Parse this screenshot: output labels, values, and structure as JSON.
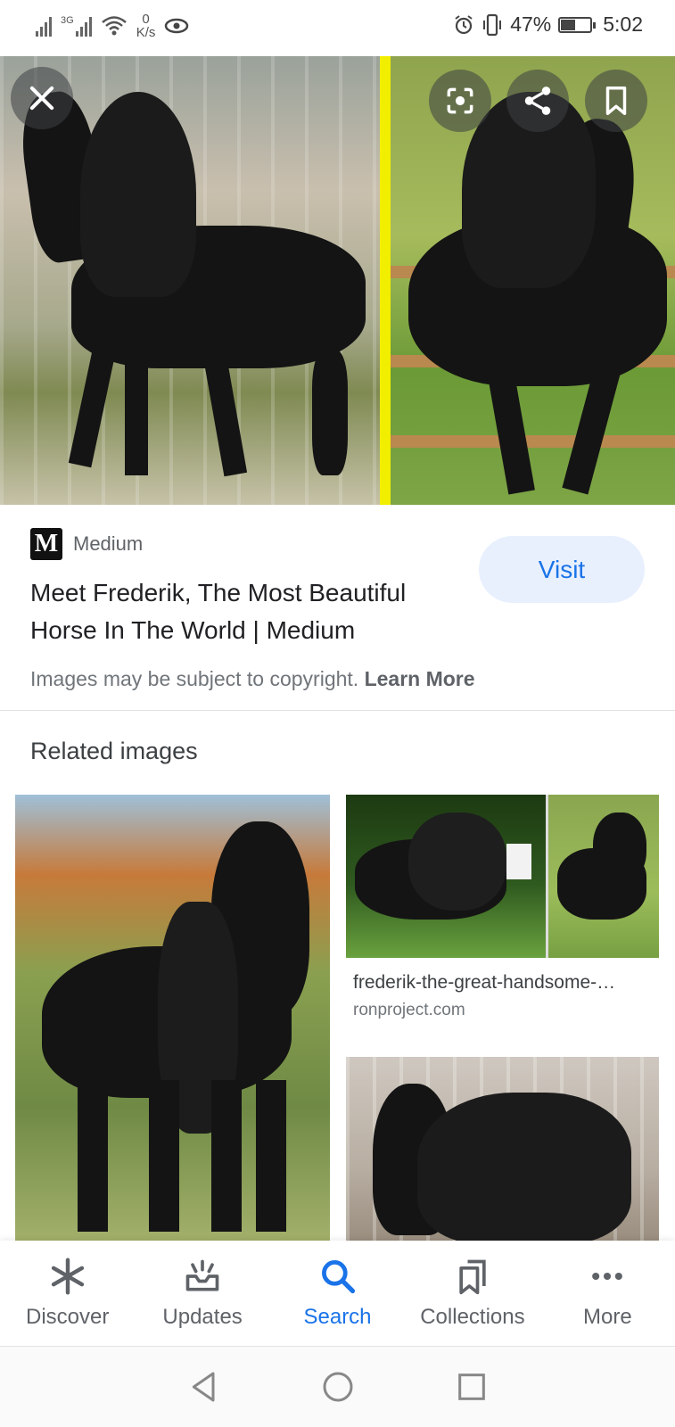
{
  "status_bar": {
    "network_type": "3G",
    "net_speed_value": "0",
    "net_speed_unit": "K/s",
    "battery_percent": "47%",
    "battery_level": 0.47,
    "time": "5:02"
  },
  "hero": {
    "icons": [
      "close-icon",
      "lens-icon",
      "share-icon",
      "bookmark-icon"
    ]
  },
  "result": {
    "source_favicon": "M",
    "source_name": "Medium",
    "title": "Meet Frederik, The Most Beautiful Horse In The World | Medium",
    "visit_label": "Visit",
    "copyright_text": "Images may be subject to copyright.",
    "learn_more": "Learn More"
  },
  "related": {
    "heading": "Related images",
    "items": [
      {
        "title": "frederik-the-great-handsome-…",
        "site": "ronproject.com"
      }
    ]
  },
  "bottom_nav": {
    "items": [
      {
        "label": "Discover",
        "icon": "asterisk-icon"
      },
      {
        "label": "Updates",
        "icon": "updates-icon"
      },
      {
        "label": "Search",
        "icon": "search-icon",
        "active": true
      },
      {
        "label": "Collections",
        "icon": "collections-icon"
      },
      {
        "label": "More",
        "icon": "more-icon"
      }
    ]
  },
  "colors": {
    "accent": "#1a73e8",
    "visit_bg": "#e8f0fe",
    "divider_yellow": "#f2ee00"
  }
}
